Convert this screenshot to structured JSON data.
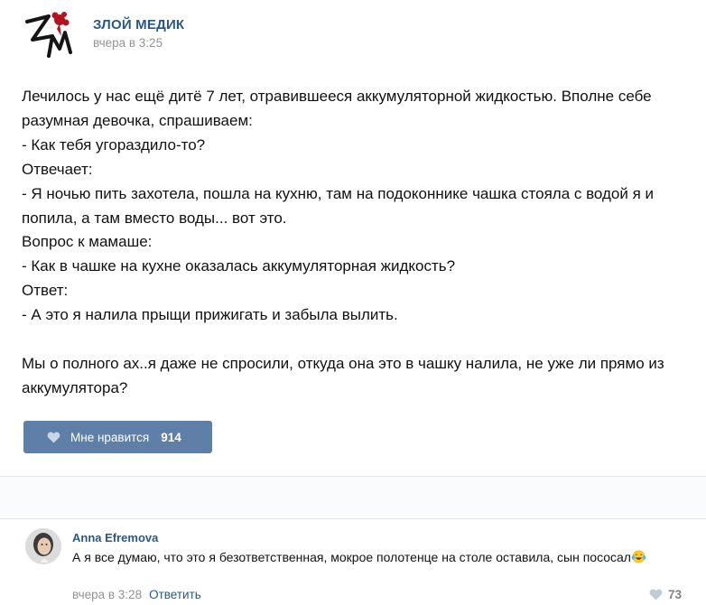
{
  "post": {
    "author": "ЗЛОЙ МЕДИК",
    "time": "вчера в 3:25",
    "text": "Лечилось у нас ещё дитё 7 лет, отравившееся аккумуляторной жидкостью. Вполне себе разумная девочка, спрашиваем:\n- Как тебя угораздило-то?\nОтвечает:\n- Я ночью пить захотела, пошла на кухню, там на подоконнике чашка стояла с водой я и попила, а там вместо воды... вот это.\nВопрос к мамаше:\n- Как в чашке на кухне оказалась аккумуляторная жидкость?\nОтвет:\n- А это я налила прыщи прижигать и забыла вылить.\n\nМы о полного ах..я даже не спросили, откуда она это в чашку налила, не уже ли прямо из аккумулятора?",
    "like_label": "Мне нравится",
    "like_count": "914"
  },
  "comment": {
    "author": "Anna Efremova",
    "text": "А я все думаю, что это я безответственная, мокрое полотенце на столе оставила, сын пососал",
    "emoji": "laughing-tears-emoji",
    "time": "вчера в 3:28",
    "reply_label": "Ответить",
    "like_count": "73"
  },
  "colors": {
    "link": "#2a5885",
    "button": "#5e80a8",
    "muted": "#939393",
    "logo_red": "#b3121f"
  }
}
